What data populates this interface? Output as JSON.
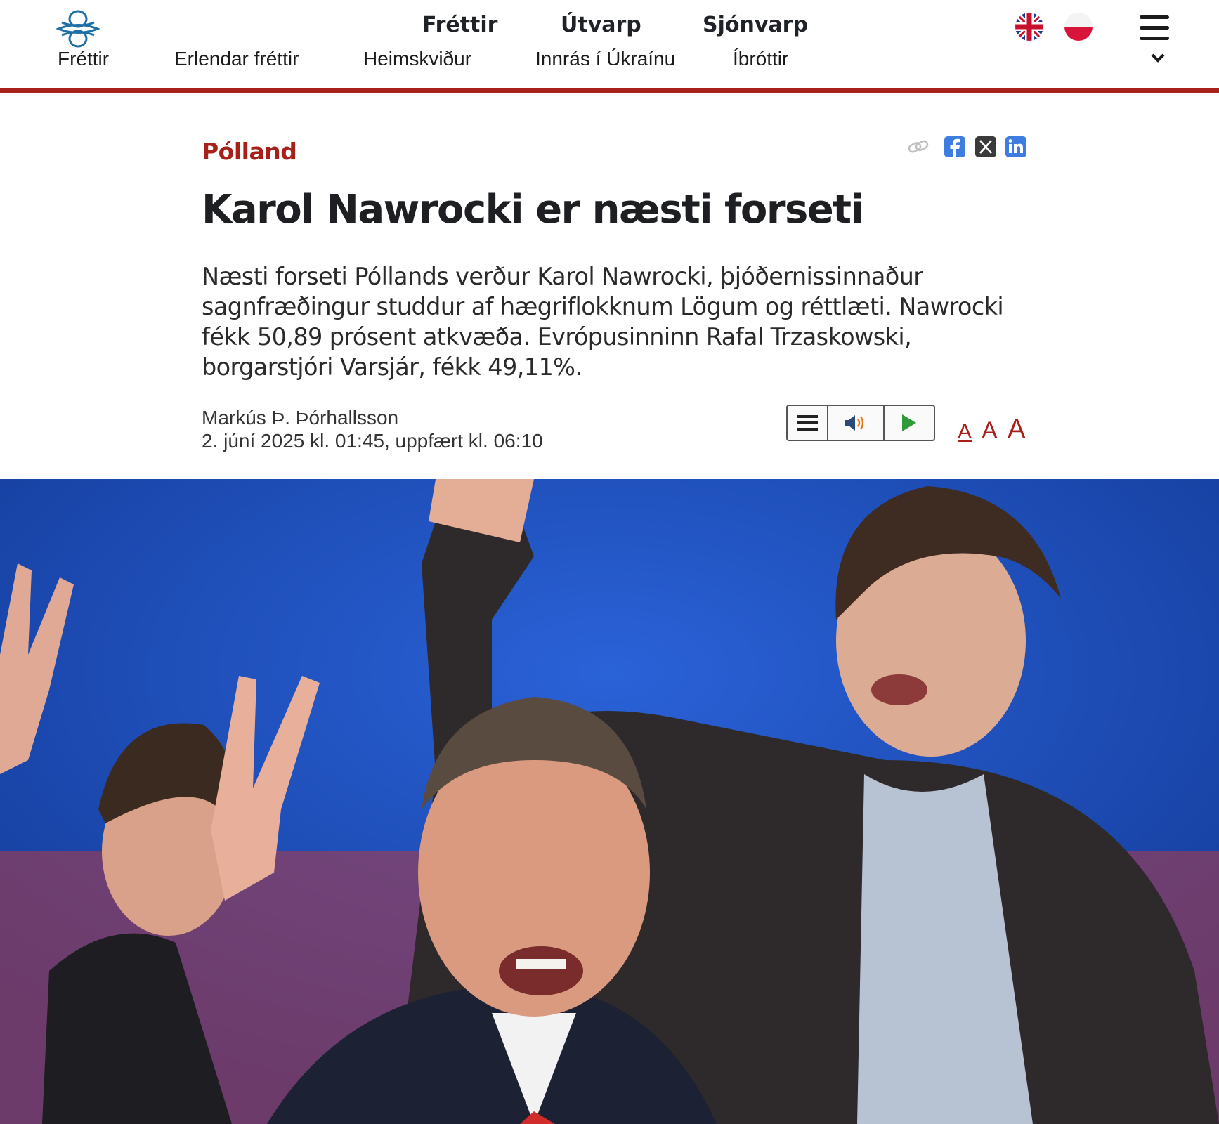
{
  "header": {
    "main_nav": [
      "Fréttir",
      "Útvarp",
      "Sjónvarp"
    ],
    "sub_nav": [
      "Fréttir",
      "Erlendar fréttir",
      "Heimskviður",
      "Innrás í Úkraínu",
      "Íþróttir"
    ],
    "logo_icon": "ruv-logo",
    "flags": [
      "uk-flag-icon",
      "poland-flag-icon"
    ],
    "menu_icon": "hamburger-menu-icon",
    "accent": "#a8201a"
  },
  "article": {
    "category": "Pólland",
    "headline": "Karol Nawrocki er næsti forseti",
    "lede": "Næsti forseti Póllands verður Karol Nawrocki, þjóðernissinnaður sagnfræðingur studdur af hægriflokknum Lögum og réttlæti. Nawrocki fékk 50,89 prósent atkvæða. Evrópusinninn Rafal Trzaskowski, borgarstjóri Varsjár, fékk 49,11%.",
    "author": "Markús Þ. Þórhallsson",
    "date": "2. júní 2025 kl. 01:45, uppfært kl. 06:10",
    "share_icons": [
      "link-icon",
      "facebook-icon",
      "x-icon",
      "linkedin-icon"
    ],
    "player_icons": [
      "text-list-icon",
      "speaker-icon",
      "play-icon"
    ],
    "font_size_labels": [
      "A",
      "A",
      "A"
    ]
  }
}
